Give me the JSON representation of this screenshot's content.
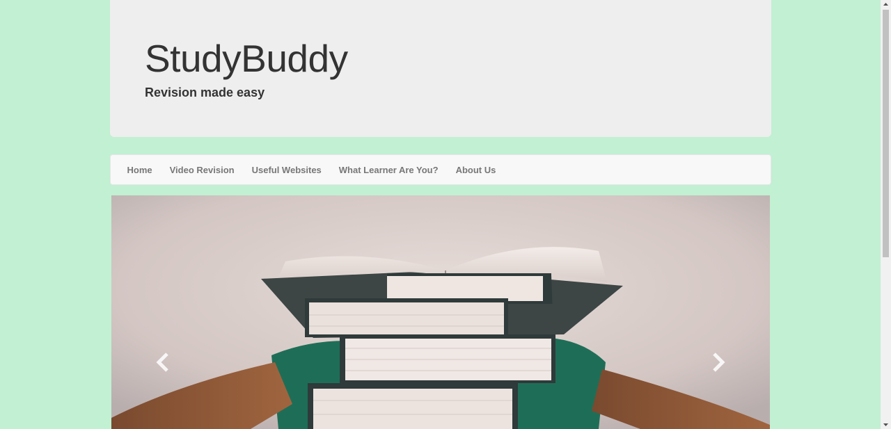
{
  "header": {
    "title": "StudyBuddy",
    "tagline": "Revision made easy"
  },
  "nav": {
    "items": [
      {
        "label": "Home"
      },
      {
        "label": "Video Revision"
      },
      {
        "label": "Useful Websites"
      },
      {
        "label": "What Learner Are You?"
      },
      {
        "label": "About Us"
      }
    ]
  },
  "carousel": {
    "image": "stack-of-books-photo",
    "prev_icon": "chevron-left-icon",
    "next_icon": "chevron-right-icon"
  },
  "colors": {
    "page_background": "#c1f0d2",
    "header_background": "#eeeeee",
    "navbar_background": "#f8f8f8",
    "nav_text": "#777777",
    "title_text": "#333333"
  }
}
